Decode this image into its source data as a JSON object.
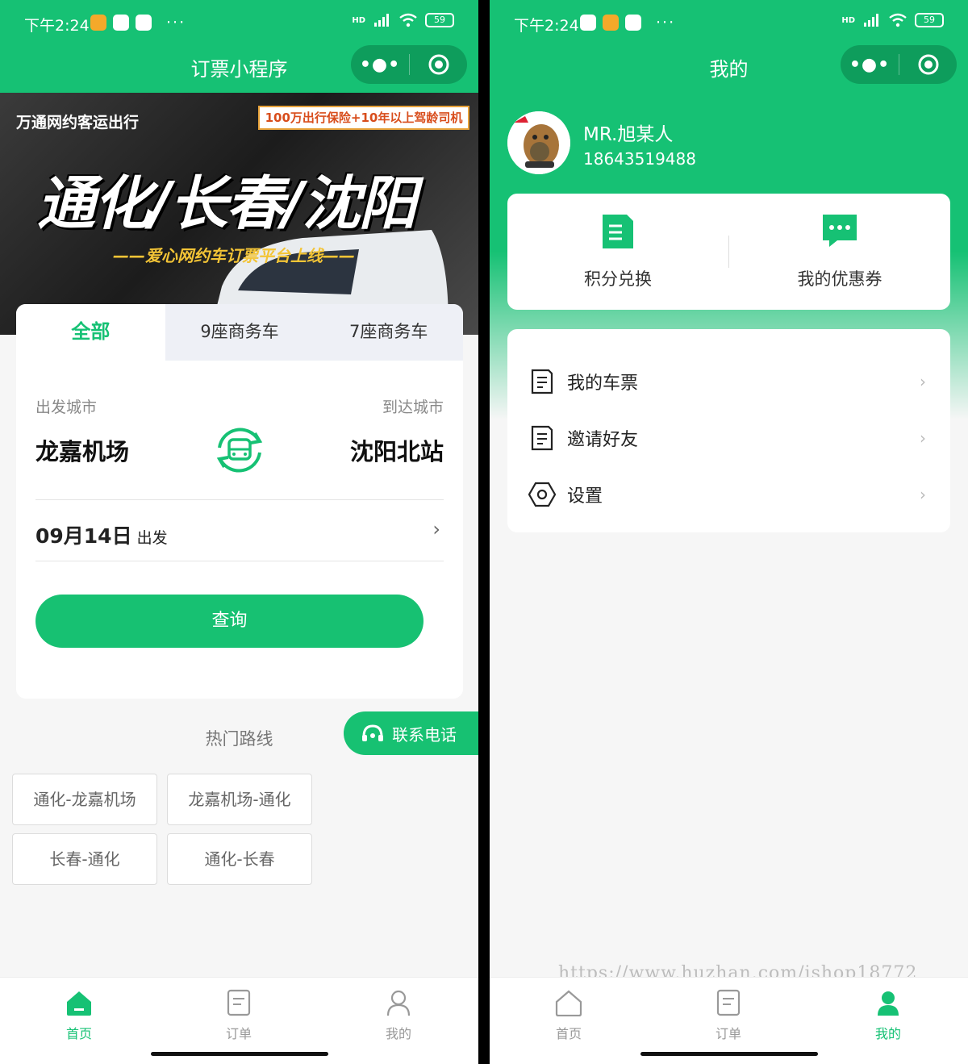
{
  "status": {
    "time": "下午2:24",
    "more": "···",
    "hd": "HD",
    "battery": "59"
  },
  "left": {
    "nav_title": "订票小程序",
    "banner": {
      "subtitle": "万通网约客运出行",
      "tag": "100万出行保险+10年以上驾龄司机",
      "headline": "通化/长春/沈阳",
      "slogan": "——爱心网约车订票平台上线——"
    },
    "tabs": [
      "全部",
      "9座商务车",
      "7座商务车"
    ],
    "from_label": "出发城市",
    "to_label": "到达城市",
    "from_city": "龙嘉机场",
    "to_city": "沈阳北站",
    "date": "09月14日",
    "date_suffix": "出发",
    "query_label": "查询",
    "hot_title": "热门路线",
    "contact_label": "联系电话",
    "routes": [
      "通化-龙嘉机场",
      "龙嘉机场-通化",
      "长春-通化",
      "通化-长春"
    ]
  },
  "right": {
    "nav_title": "我的",
    "username": "MR.旭某人",
    "phone": "18643519488",
    "actions": [
      "积分兑换",
      "我的优惠券"
    ],
    "menu": [
      "我的车票",
      "邀请好友",
      "设置"
    ],
    "watermark": "https://www.huzhan.com/ishop18772"
  },
  "tabbar": [
    "首页",
    "订单",
    "我的"
  ],
  "colors": {
    "accent": "#16c174",
    "capsule": "#0e9d5c"
  }
}
